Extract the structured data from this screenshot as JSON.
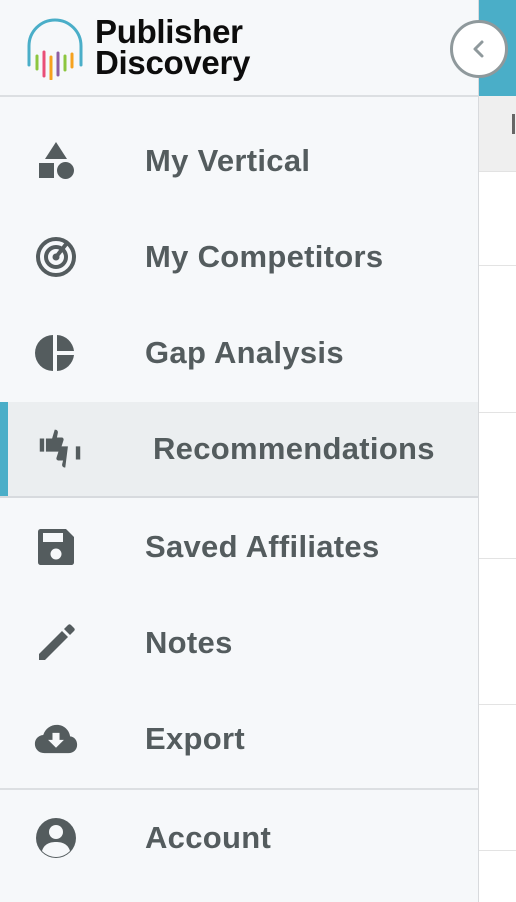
{
  "brand": {
    "line1": "Publisher",
    "line2": "Discovery",
    "logo_icon": "soundwave-headphones-logo-icon",
    "logo_colors": [
      "#4aaec8",
      "#8cc63f",
      "#e94e77",
      "#f6a21e",
      "#8e5ea2"
    ]
  },
  "collapse_button": {
    "icon": "chevron-left-icon"
  },
  "nav": {
    "items": [
      {
        "label": "My Vertical",
        "icon": "shapes-icon"
      },
      {
        "label": "My Competitors",
        "icon": "radar-target-icon"
      },
      {
        "label": "Gap Analysis",
        "icon": "pie-chart-icon"
      },
      {
        "label": "Recommendations",
        "icon": "thumbs-up-down-icon",
        "active": true
      },
      {
        "label": "Saved Affiliates",
        "icon": "save-floppy-icon"
      },
      {
        "label": "Notes",
        "icon": "pencil-icon"
      },
      {
        "label": "Export",
        "icon": "cloud-download-icon"
      }
    ],
    "account": {
      "label": "Account",
      "icon": "account-circle-icon"
    }
  },
  "colors": {
    "accent": "#4aaec8",
    "icon": "#545c5e",
    "text": "#545c5e",
    "sidebar_bg": "#f6f8fa",
    "active_bg": "#ebeef0"
  }
}
